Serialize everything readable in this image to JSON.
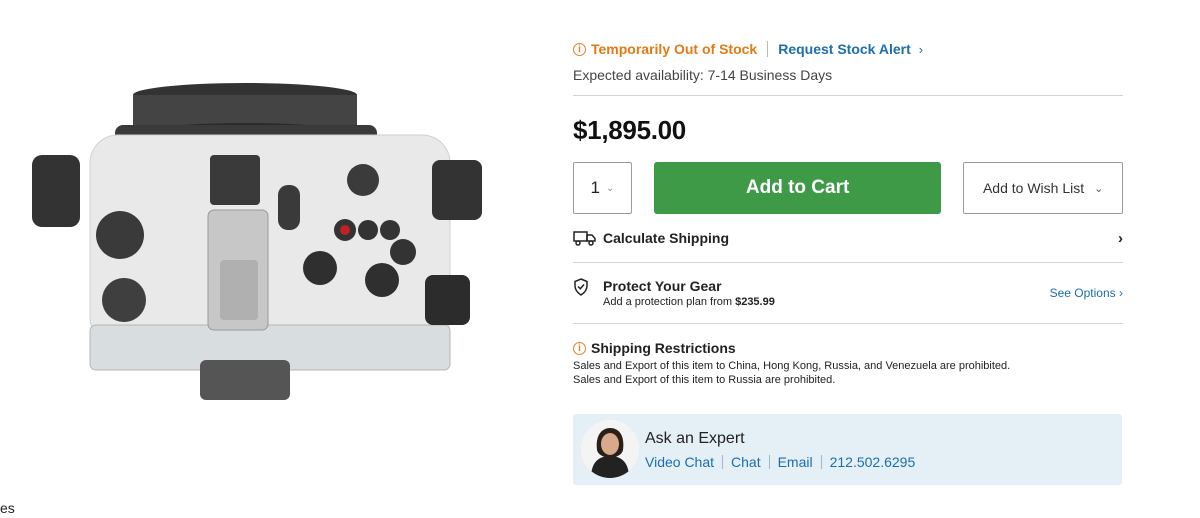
{
  "left_cut_text": "es",
  "stock": {
    "status": "Temporarily Out of Stock",
    "alert_link": "Request Stock Alert",
    "availability": "Expected availability: 7-14 Business Days"
  },
  "price": "$1,895.00",
  "buy": {
    "quantity": "1",
    "add_to_cart": "Add to Cart",
    "wish_list": "Add to Wish List"
  },
  "shipping": {
    "label": "Calculate Shipping"
  },
  "protect": {
    "title": "Protect Your Gear",
    "subtitle_prefix": "Add a protection plan from ",
    "subtitle_price": "$235.99",
    "link": "See Options"
  },
  "restrictions": {
    "title": "Shipping Restrictions",
    "lines": [
      "Sales and Export of this item to China, Hong Kong, Russia, and Venezuela are prohibited.",
      "Sales and Export of this item to Russia are prohibited."
    ]
  },
  "expert": {
    "title": "Ask an Expert",
    "links": [
      "Video Chat",
      "Chat",
      "Email",
      "212.502.6295"
    ]
  },
  "colors": {
    "accent_blue": "#1b6eb0",
    "cart_green": "#3f9a48",
    "warning_orange": "#e37a14",
    "expert_bg": "#e4eff6"
  },
  "icons": [
    "info-icon",
    "chevron-right-icon",
    "chevron-down-icon",
    "truck-icon",
    "shield-icon",
    "expert-avatar"
  ]
}
